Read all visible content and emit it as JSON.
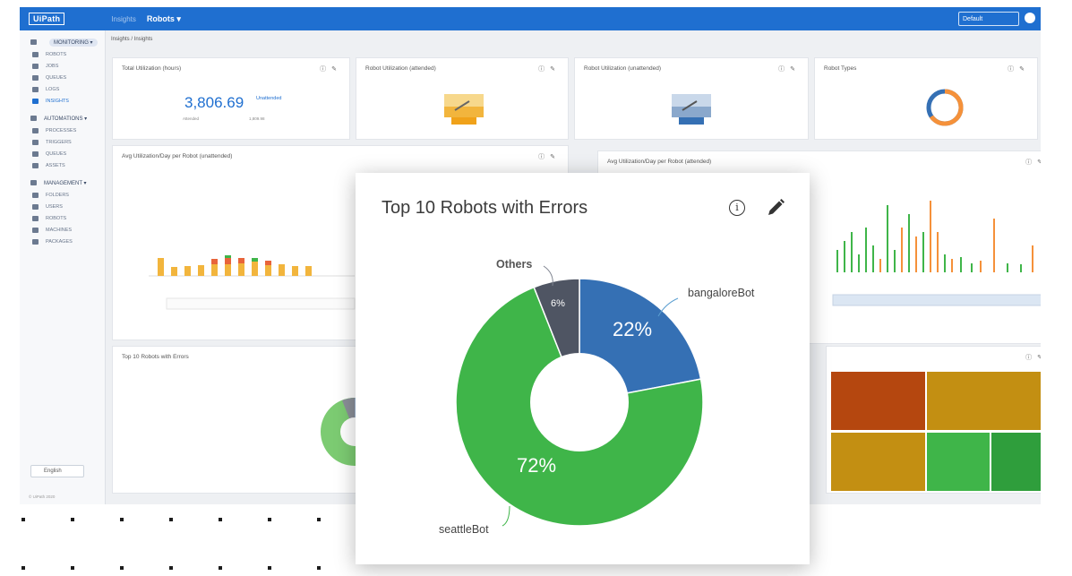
{
  "topbar": {
    "logo": "UiPath",
    "crumb_dim": "Insights",
    "crumb_main": "Robots ▾",
    "tenant": "Default"
  },
  "sidebar": {
    "groups": [
      {
        "label": "MONITORING ▾",
        "items": [
          "ROBOTS",
          "JOBS",
          "QUEUES",
          "LOGS",
          "INSIGHTS"
        ]
      },
      {
        "label": "AUTOMATIONS ▾",
        "items": [
          "PROCESSES",
          "TRIGGERS",
          "QUEUES",
          "ASSETS"
        ]
      },
      {
        "label": "MANAGEMENT ▾",
        "items": [
          "FOLDERS",
          "USERS",
          "ROBOTS",
          "MACHINES",
          "PACKAGES"
        ]
      }
    ],
    "active_item": "INSIGHTS",
    "language": "English",
    "footer": "© UiPath 2020"
  },
  "page_crumb": "Insights / Insights",
  "cards": {
    "total_utilization": {
      "title": "Total Utilization (hours)",
      "value": "3,806.69",
      "value_label": "Unattended",
      "sub_left": "Attended",
      "sub_right": "1,809.98"
    },
    "robot_util_attended": {
      "title": "Robot Utilization (attended)"
    },
    "robot_util_unattended": {
      "title": "Robot Utilization (unattended)"
    },
    "robot_types": {
      "title": "Robot Types"
    },
    "avg_unattended": {
      "title": "Avg Utilization/Day per Robot (unattended)"
    },
    "avg_attended": {
      "title": "Avg Utilization/Day per Robot (attended)"
    },
    "bg_errors": {
      "title": "Top 10 Robots with Errors"
    }
  },
  "focus_card": {
    "title": "Top 10 Robots with Errors",
    "icons": [
      "info-icon",
      "edit-pencil-icon"
    ],
    "colors": {
      "bangaloreBot": "#3570b4",
      "seattleBot": "#3fb549",
      "Others": "#4f5563"
    }
  },
  "chart_data": {
    "type": "pie",
    "title": "Top 10 Robots with Errors",
    "slices": [
      {
        "label": "bangaloreBot",
        "value": 22,
        "display": "22%"
      },
      {
        "label": "seattleBot",
        "value": 72,
        "display": "72%"
      },
      {
        "label": "Others",
        "value": 6,
        "display": "6%"
      }
    ],
    "donut": true
  }
}
